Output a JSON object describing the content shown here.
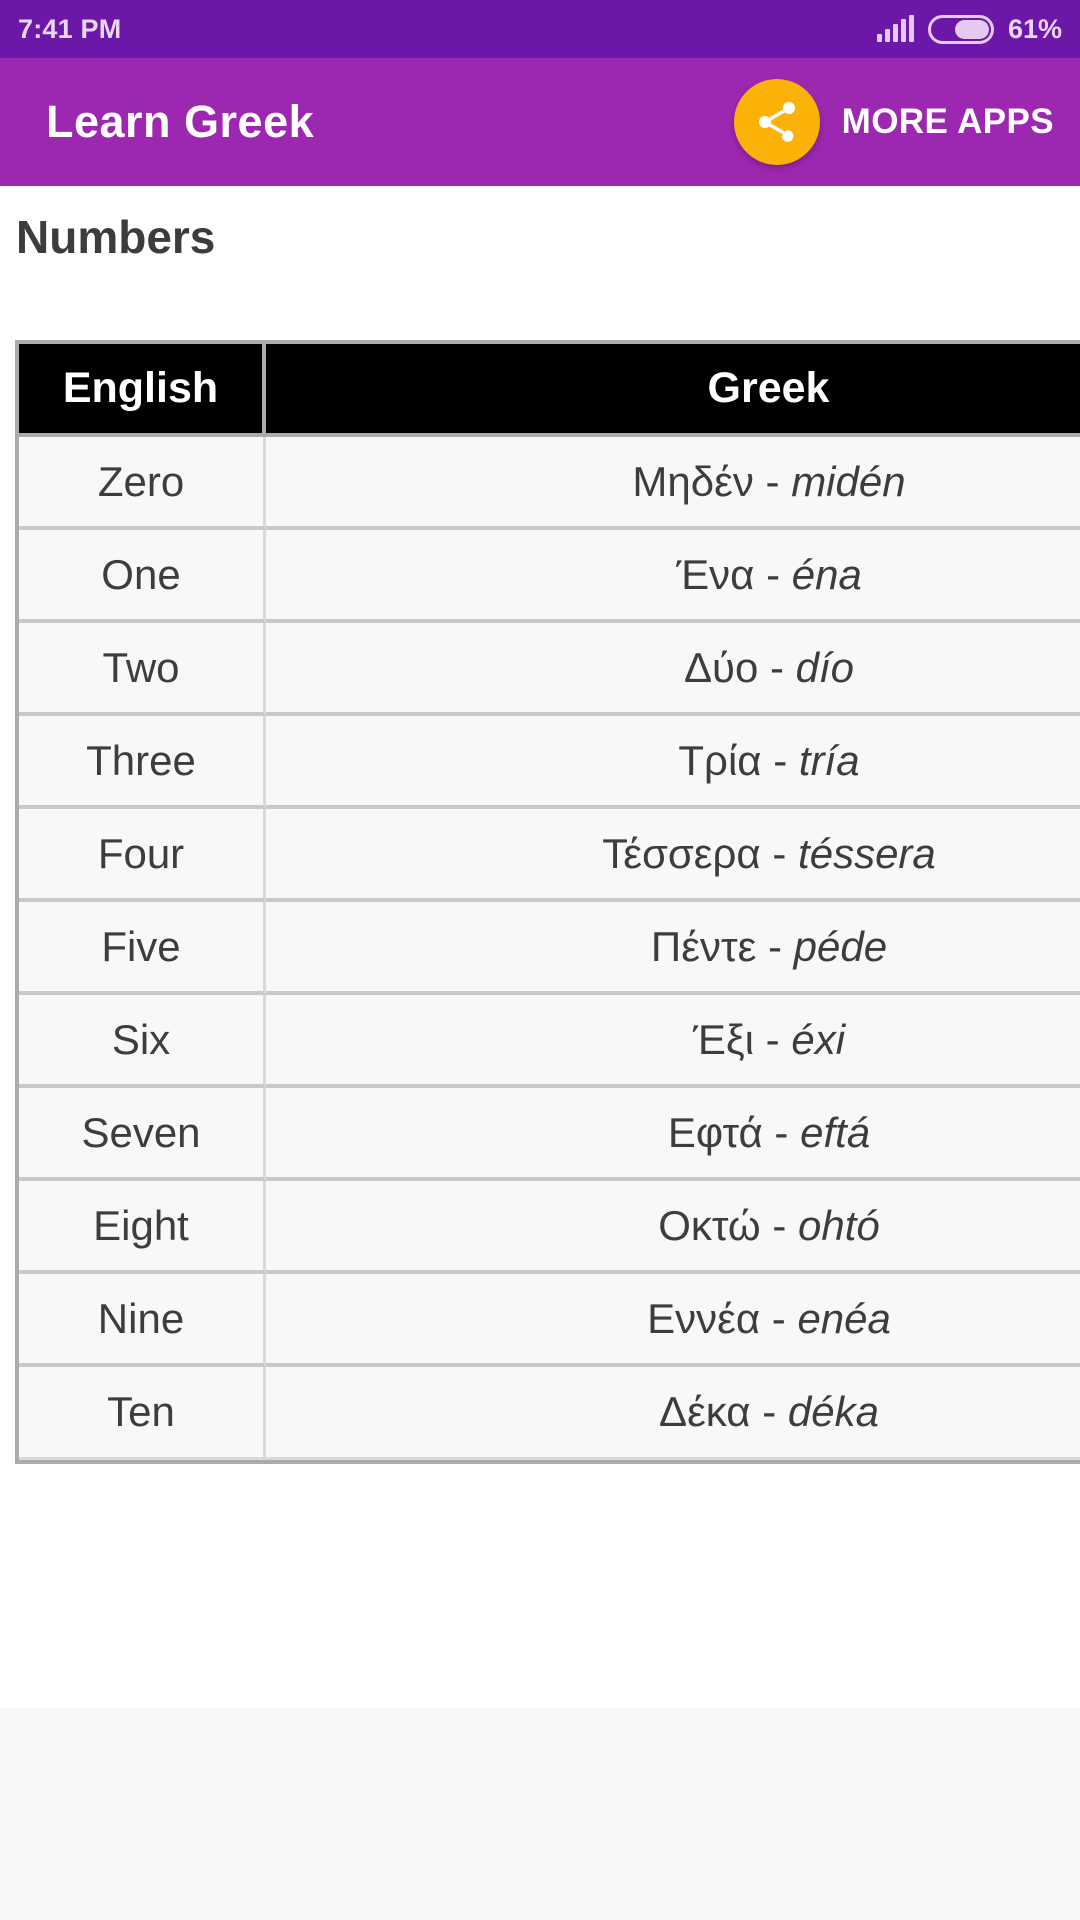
{
  "statusbar": {
    "time": "7:41 PM",
    "battery_percent": "61%",
    "battery_level": 61,
    "signal_icon": "signal-bars-icon",
    "battery_icon": "battery-icon",
    "bg_color": "#6B17A8"
  },
  "appbar": {
    "title": "Learn Greek",
    "share_icon": "share-icon",
    "more_apps_label": "MORE APPS",
    "bg_color": "#9C27B0",
    "share_button_color": "#FBB208"
  },
  "page": {
    "title": "Numbers"
  },
  "table": {
    "columns": [
      "English",
      "Greek"
    ],
    "rows": [
      {
        "english": "Zero",
        "greek": "Μηδέν",
        "translit": "midén"
      },
      {
        "english": "One",
        "greek": "Ένα",
        "translit": "éna"
      },
      {
        "english": "Two",
        "greek": "Δύο",
        "translit": "dío"
      },
      {
        "english": "Three",
        "greek": "Τρία",
        "translit": "tría"
      },
      {
        "english": "Four",
        "greek": "Τέσσερα",
        "translit": "téssera"
      },
      {
        "english": "Five",
        "greek": "Πέντε",
        "translit": "péde"
      },
      {
        "english": "Six",
        "greek": "Έξι",
        "translit": "éxi"
      },
      {
        "english": "Seven",
        "greek": "Εφτά",
        "translit": "eftá"
      },
      {
        "english": "Eight",
        "greek": "Οκτώ",
        "translit": "ohtó"
      },
      {
        "english": "Nine",
        "greek": "Εννέα",
        "translit": "enéa"
      },
      {
        "english": "Ten",
        "greek": "Δέκα",
        "translit": "déka"
      }
    ],
    "separator": " - "
  }
}
